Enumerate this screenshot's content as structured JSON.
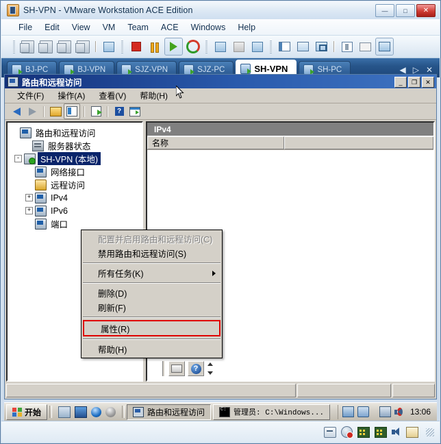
{
  "vmware": {
    "title": "SH-VPN - VMware Workstation ACE Edition",
    "icon": "vmware-icon",
    "window_buttons": [
      {
        "name": "minimize-button",
        "glyph": "—"
      },
      {
        "name": "maximize-button",
        "glyph": "□"
      },
      {
        "name": "close-button",
        "glyph": "✕"
      }
    ],
    "menu": [
      "File",
      "Edit",
      "View",
      "VM",
      "Team",
      "ACE",
      "Windows",
      "Help"
    ],
    "toolbar_icons": [
      "power-off-icon",
      "suspend-stack-icon",
      "reset-icon",
      "usb-icon",
      "full-screen-exit-icon",
      "stop-icon",
      "pause-icon",
      "play-icon",
      "revert-icon",
      "take-snapshot-icon",
      "revert-snapshot-icon",
      "snapshot-manager-icon",
      "show-sidebar-icon",
      "fit-guest-icon",
      "unity-icon",
      "settings-icon",
      "summary-icon",
      "multiple-windows-icon"
    ],
    "tabs": [
      {
        "label": "BJ-PC",
        "active": false
      },
      {
        "label": "BJ-VPN",
        "active": false
      },
      {
        "label": "SJZ-VPN",
        "active": false
      },
      {
        "label": "SJZ-PC",
        "active": false
      },
      {
        "label": "SH-VPN",
        "active": true
      },
      {
        "label": "SH-PC",
        "active": false
      }
    ],
    "tab_nav": [
      {
        "name": "tab-scroll-left-icon",
        "glyph": "◀"
      },
      {
        "name": "tab-scroll-right-icon",
        "glyph": "▷"
      },
      {
        "name": "tab-close-icon",
        "glyph": "✕"
      }
    ]
  },
  "mmc": {
    "title": "路由和远程访问",
    "window_buttons": [
      {
        "name": "mmc-minimize-button",
        "glyph": "_"
      },
      {
        "name": "mmc-restore-button",
        "glyph": "❐"
      },
      {
        "name": "mmc-close-button",
        "glyph": "✕"
      }
    ],
    "menu": [
      "文件(F)",
      "操作(A)",
      "查看(V)",
      "帮助(H)"
    ],
    "toolbar_icons": [
      "back-arrow-icon",
      "forward-arrow-icon",
      "up-folder-icon",
      "show-hide-tree-icon",
      "export-list-icon",
      "help-icon",
      "show-action-pane-icon"
    ],
    "tree": [
      {
        "label": "路由和远程访问",
        "icon": "console-root-icon",
        "indent": 0,
        "expander": "",
        "selected": false
      },
      {
        "label": "服务器状态",
        "icon": "server-status-icon",
        "indent": 1,
        "expander": "",
        "selected": false
      },
      {
        "label": "SH-VPN (本地)",
        "icon": "server-vpn-icon",
        "indent": 1,
        "expander": "-",
        "selected": true
      },
      {
        "label": "网络接口",
        "icon": "network-interface-icon",
        "indent": 2,
        "expander": "",
        "selected": false
      },
      {
        "label": "远程访问",
        "icon": "remote-access-folder-icon",
        "indent": 2,
        "expander": "",
        "selected": false
      },
      {
        "label": "IPv4",
        "icon": "ipv4-icon",
        "indent": 2,
        "expander": "+",
        "selected": false
      },
      {
        "label": "IPv6",
        "icon": "ipv6-icon",
        "indent": 2,
        "expander": "+",
        "selected": false
      },
      {
        "label": "端口",
        "icon": "ports-icon",
        "indent": 2,
        "expander": "",
        "selected": false
      }
    ],
    "list": {
      "header": "IPv4",
      "columns": [
        "名称",
        ""
      ],
      "rows": []
    },
    "list_status_icons": [
      "keyboard-icon",
      "help-round-icon",
      "spinner-icon"
    ]
  },
  "context_menu": {
    "items": [
      {
        "label": "配置并启用路由和远程访问(C)",
        "name": "menu-configure-enable",
        "disabled": true,
        "submenu": false,
        "highlight": false
      },
      {
        "label": "禁用路由和远程访问(S)",
        "name": "menu-disable-routing",
        "disabled": false,
        "submenu": false,
        "highlight": false
      },
      {
        "separator": true
      },
      {
        "label": "所有任务(K)",
        "name": "menu-all-tasks",
        "disabled": false,
        "submenu": true,
        "highlight": false
      },
      {
        "separator": true
      },
      {
        "label": "删除(D)",
        "name": "menu-delete",
        "disabled": false,
        "submenu": false,
        "highlight": false
      },
      {
        "label": "刷新(F)",
        "name": "menu-refresh",
        "disabled": false,
        "submenu": false,
        "highlight": false
      },
      {
        "separator": true
      },
      {
        "label": "属性(R)",
        "name": "menu-properties",
        "disabled": false,
        "submenu": false,
        "highlight": true
      },
      {
        "separator": true
      },
      {
        "label": "帮助(H)",
        "name": "menu-help",
        "disabled": false,
        "submenu": false,
        "highlight": false
      }
    ],
    "highlight_color": "#e00000"
  },
  "taskbar": {
    "start_label": "开始",
    "quick_launch": [
      "show-desktop-icon",
      "desktop-icon",
      "internet-explorer-icon",
      "ie-gray-icon"
    ],
    "buttons": [
      {
        "label": "路由和远程访问",
        "icon": "mmc-window-icon",
        "pressed": true
      },
      {
        "label": "管理员: C:\\Windows...",
        "icon": "command-prompt-icon",
        "pressed": false
      }
    ],
    "tray_icons": [
      "network-share-icon",
      "network-connections-icon",
      "network-status-icon",
      "volume-muted-icon"
    ],
    "clock": "13:06"
  },
  "vm_status_icons": [
    "floppy-drive-icon",
    "hard-disk-icon",
    "network-adapter-1-icon",
    "network-adapter-2-icon",
    "sound-icon",
    "printer-icon"
  ]
}
